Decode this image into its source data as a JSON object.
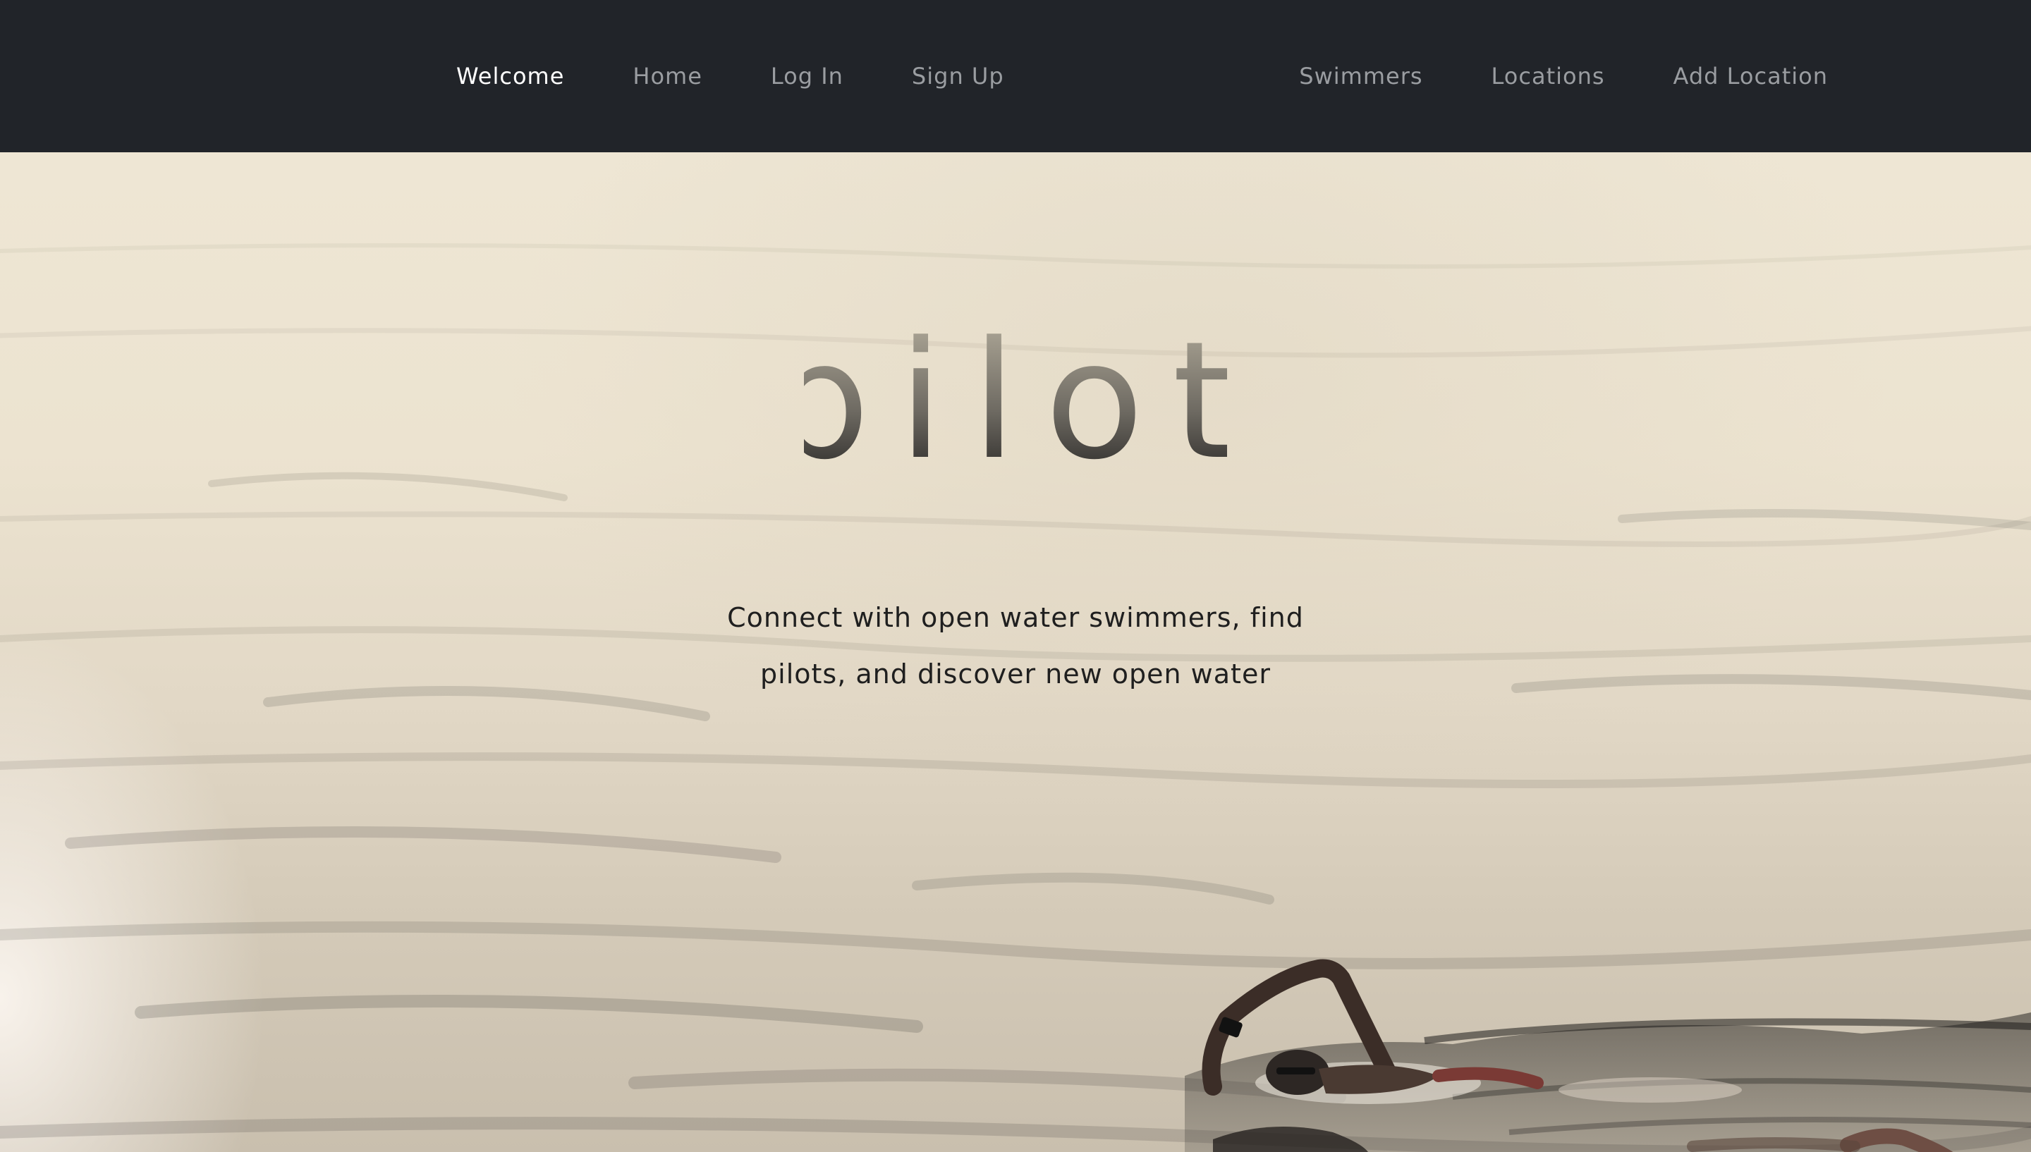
{
  "nav": {
    "left_items": [
      {
        "label": "Welcome",
        "active": true
      },
      {
        "label": "Home",
        "active": false
      },
      {
        "label": "Log In",
        "active": false
      },
      {
        "label": "Sign Up",
        "active": false
      }
    ],
    "right_items": [
      {
        "label": "Swimmers",
        "active": false
      },
      {
        "label": "Locations",
        "active": false
      },
      {
        "label": "Add Location",
        "active": false
      }
    ]
  },
  "hero": {
    "logo_text": "pilot",
    "tagline_line1": "Connect with open water swimmers, find",
    "tagline_line2": "pilots, and discover new open water",
    "background_image": "open-water-swimmer-photo"
  },
  "colors": {
    "navbar_bg": "#212429",
    "nav_inactive": "#9a9da1",
    "nav_active": "#ffffff",
    "tagline": "#1f1f1f",
    "water_light": "#eee6d4"
  }
}
